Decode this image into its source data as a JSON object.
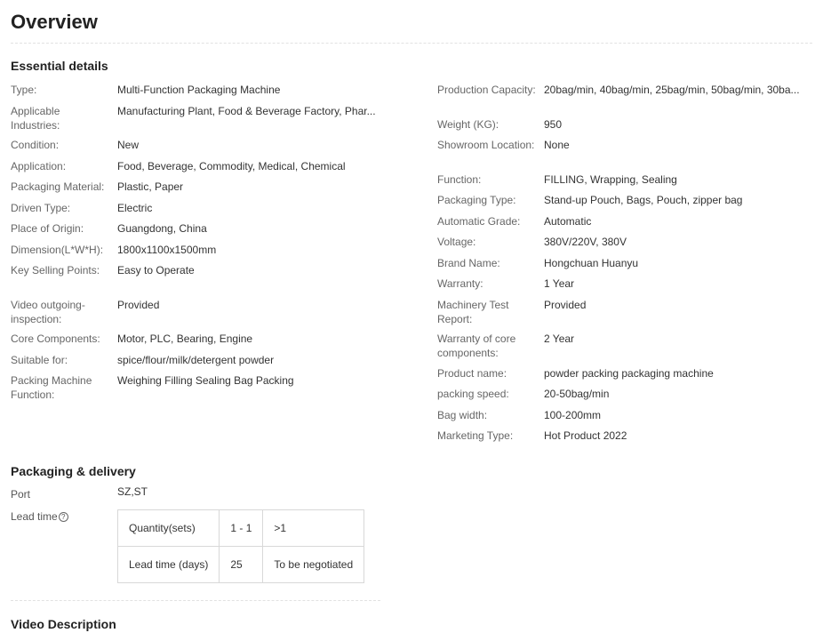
{
  "page_title": "Overview",
  "essential_details": {
    "title": "Essential details",
    "left": [
      {
        "label": "Type:",
        "value": "Multi-Function Packaging Machine",
        "lines": 1
      },
      {
        "label": "Applicable Industries:",
        "value": "Manufacturing Plant, Food & Beverage Factory, Phar...",
        "lines": 3
      },
      {
        "label": "Condition:",
        "value": "New",
        "lines": 1
      },
      {
        "label": "Application:",
        "value": "Food, Beverage, Commodity, Medical, Chemical",
        "lines": 1
      },
      {
        "label": "Packaging Material:",
        "value": "Plastic, Paper",
        "lines": 1
      },
      {
        "label": "Driven Type:",
        "value": "Electric",
        "lines": 1
      },
      {
        "label": "Place of Origin:",
        "value": "Guangdong, China",
        "lines": 1
      },
      {
        "label": "Dimension(L*W*H):",
        "value": "1800x1100x1500mm",
        "lines": 1
      },
      {
        "label": "Key Selling Points:",
        "value": "Easy to Operate",
        "lines": 2
      },
      {
        "label": "Video outgoing-inspection:",
        "value": "Provided",
        "lines": 2
      },
      {
        "label": "Core Components:",
        "value": "Motor, PLC, Bearing, Engine",
        "lines": 1
      },
      {
        "label": "Suitable for:",
        "value": "spice/flour/milk/detergent powder",
        "lines": 1
      },
      {
        "label": "Packing Machine Function:",
        "value": "Weighing Filling Sealing Bag Packing",
        "lines": 2
      }
    ],
    "right": [
      {
        "label": "Production Capacity:",
        "value": "20bag/min, 40bag/min, 25bag/min, 50bag/min, 30ba...",
        "lines": 2
      },
      {
        "label": "Weight (KG):",
        "value": "950",
        "lines": 1
      },
      {
        "label": "Showroom Location:",
        "value": "None",
        "lines": 2
      },
      {
        "label": "Function:",
        "value": "FILLING, Wrapping, Sealing",
        "lines": 1
      },
      {
        "label": "Packaging Type:",
        "value": "Stand-up Pouch, Bags, Pouch, zipper bag",
        "lines": 1
      },
      {
        "label": "Automatic Grade:",
        "value": "Automatic",
        "lines": 1
      },
      {
        "label": "Voltage:",
        "value": "380V/220V, 380V",
        "lines": 1
      },
      {
        "label": "Brand Name:",
        "value": "Hongchuan Huanyu",
        "lines": 1
      },
      {
        "label": "Warranty:",
        "value": "1 Year",
        "lines": 1
      },
      {
        "label": "Machinery Test Report:",
        "value": "Provided",
        "lines": 2
      },
      {
        "label": "Warranty of core components:",
        "value": "2 Year",
        "lines": 2
      },
      {
        "label": "Product name:",
        "value": "powder packing packaging machine",
        "lines": 1
      },
      {
        "label": "packing speed:",
        "value": "20-50bag/min",
        "lines": 1
      },
      {
        "label": "Bag width:",
        "value": "100-200mm",
        "lines": 1
      },
      {
        "label": "Marketing Type:",
        "value": "Hot Product 2022",
        "lines": 1
      }
    ]
  },
  "packaging": {
    "title": "Packaging & delivery",
    "port_label": "Port",
    "port_value": "SZ,ST",
    "lead_label": "Lead time",
    "help_icon": "?",
    "table": [
      [
        "Quantity(sets)",
        "1 - 1",
        ">1"
      ],
      [
        "Lead time (days)",
        "25",
        "To be negotiated"
      ]
    ]
  },
  "video_title": "Video Description"
}
